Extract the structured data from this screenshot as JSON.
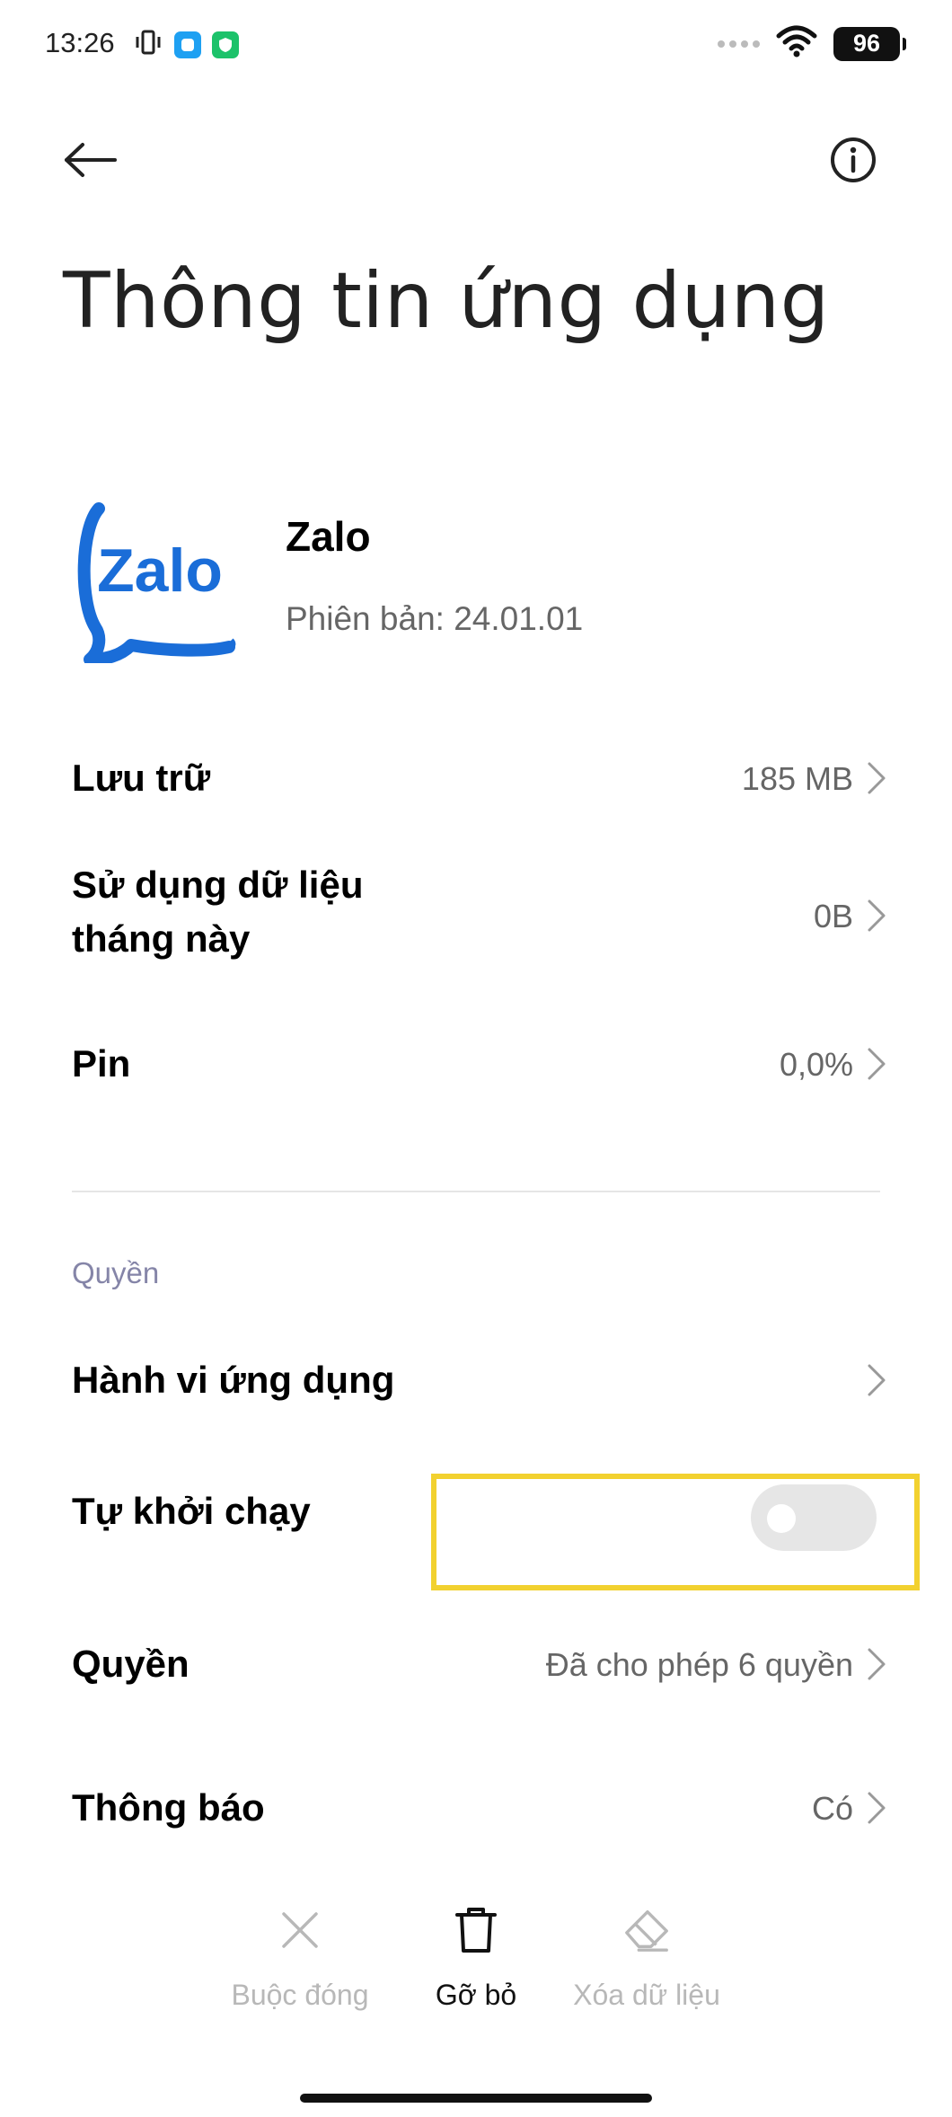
{
  "status_bar": {
    "time": "13:26",
    "battery": "96"
  },
  "header": {
    "title": "Thông tin ứng dụng"
  },
  "app": {
    "name": "Zalo",
    "version": "Phiên bản: 24.01.01",
    "icon_text": "Zalo",
    "brand_color": "#1a6dd8"
  },
  "rows": {
    "storage": {
      "label": "Lưu trữ",
      "value": "185 MB"
    },
    "data_usage": {
      "label_line1": "Sử dụng dữ liệu",
      "label_line2": "tháng này",
      "value": "0B"
    },
    "battery": {
      "label": "Pin",
      "value": "0,0%"
    }
  },
  "permissions_section": {
    "title": "Quyền",
    "app_behavior": {
      "label": "Hành vi ứng dụng"
    },
    "autostart": {
      "label": "Tự khởi chạy",
      "enabled": false
    },
    "permissions": {
      "label": "Quyền",
      "value": "Đã cho phép 6 quyền"
    },
    "notifications": {
      "label": "Thông báo",
      "value": "Có"
    }
  },
  "actions": {
    "force_stop": "Buộc đóng",
    "uninstall": "Gỡ bỏ",
    "clear_data": "Xóa dữ liệu"
  },
  "colors": {
    "highlight": "#f2d12f",
    "section_title": "#8585a8"
  }
}
